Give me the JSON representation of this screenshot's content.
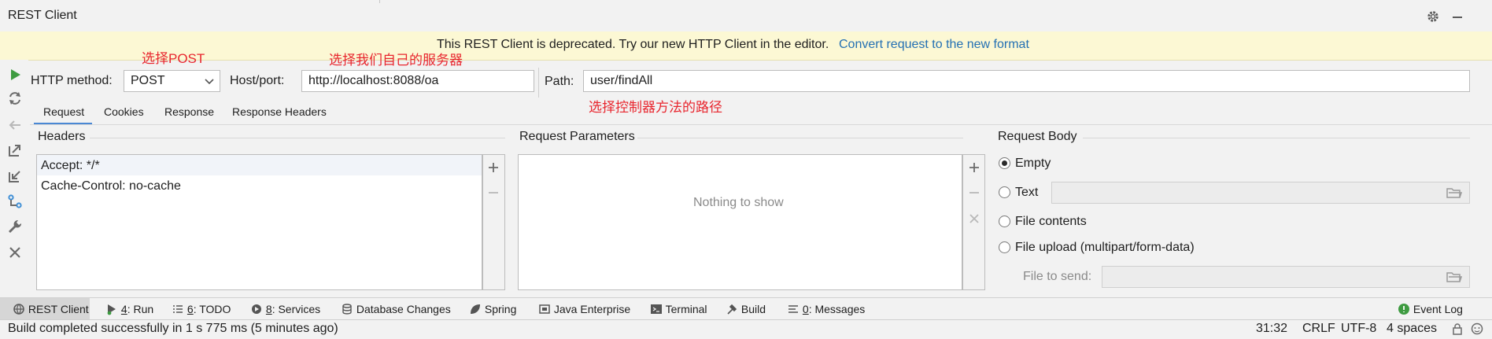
{
  "window": {
    "title": "REST Client"
  },
  "banner": {
    "message": "This REST Client is deprecated. Try our new HTTP Client in the editor.",
    "link": "Convert request to the new format"
  },
  "request": {
    "method_label": "HTTP method:",
    "method_value": "POST",
    "host_label": "Host/port:",
    "host_value": "http://localhost:8088/oa",
    "path_label": "Path:",
    "path_value": "user/findAll"
  },
  "annotations": {
    "post": "选择POST",
    "server": "选择我们自己的服务器",
    "path": "选择控制器方法的路径"
  },
  "tabs": [
    "Request",
    "Cookies",
    "Response",
    "Response Headers"
  ],
  "headers": {
    "title": "Headers",
    "rows": [
      "Accept: */*",
      "Cache-Control: no-cache"
    ]
  },
  "params": {
    "title": "Request Parameters",
    "empty_text": "Nothing to show"
  },
  "body": {
    "title": "Request Body",
    "options": [
      "Empty",
      "Text",
      "File contents",
      "File upload (multipart/form-data)"
    ],
    "selected": "Empty",
    "file_to_send_label": "File to send:"
  },
  "toolwindows": {
    "rest_client": "REST Client",
    "run_num": "4",
    "run": ": Run",
    "todo_num": "6",
    "todo": ": TODO",
    "services_num": "8",
    "services": ": Services",
    "db_changes": "Database Changes",
    "spring": "Spring",
    "java_ee": "Java Enterprise",
    "terminal": "Terminal",
    "build": "Build",
    "messages_num": "0",
    "messages": ": Messages",
    "event_log": "Event Log"
  },
  "status": {
    "message": "Build completed successfully in 1 s 775 ms (5 minutes ago)",
    "position": "31:32",
    "line_sep": "CRLF",
    "encoding": "UTF-8",
    "indent": "4 spaces"
  },
  "colors": {
    "accent": "#4a88d4",
    "link": "#2470b3",
    "annotation": "#e8262e",
    "banner_bg": "#fcf8d4",
    "run_green": "#3e9b41"
  }
}
